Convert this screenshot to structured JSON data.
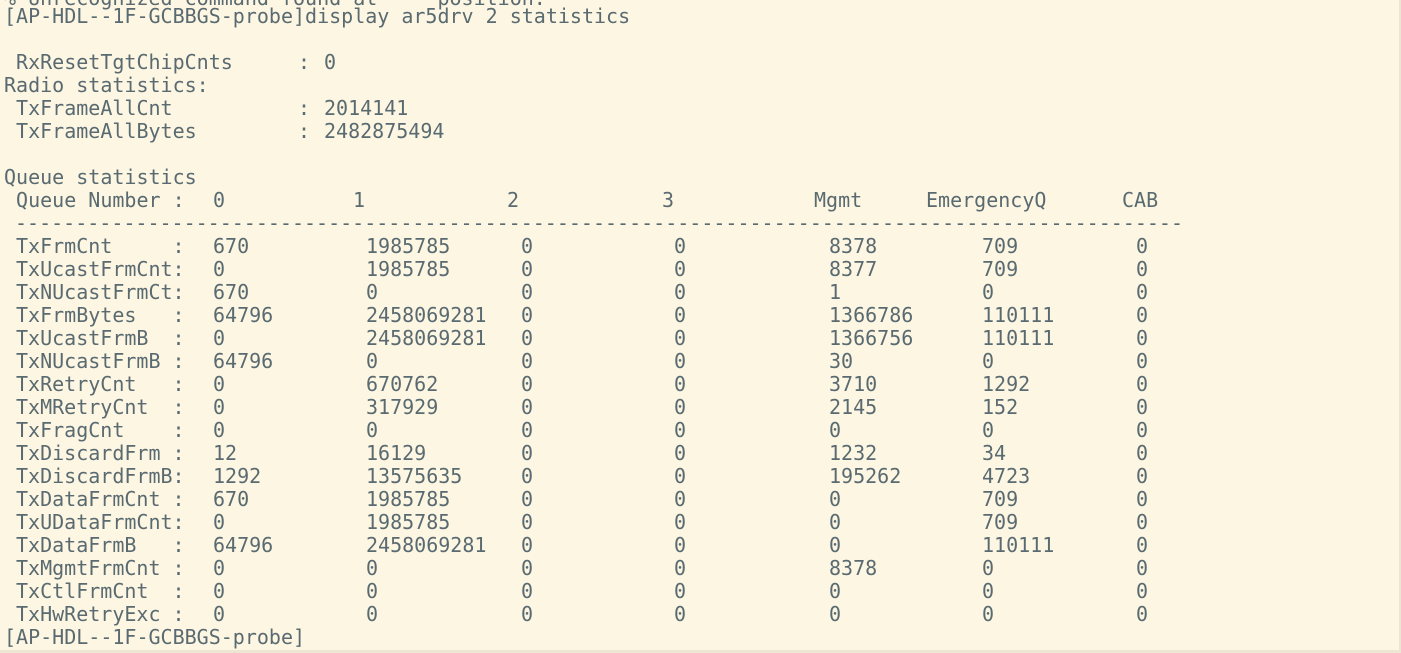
{
  "clipped_top_line": "% Unrecognized command found at '^' position.",
  "header": {
    "command_prompt": "[AP-HDL--1F-GCBBGS-probe]display ar5drv 2 statistics"
  },
  "reset": {
    "label": " RxResetTgtChipCnts",
    "sep": "  : ",
    "value": "0"
  },
  "radio": {
    "title": "Radio statistics:",
    "items": [
      {
        "label": " TxFrameAllCnt",
        "value": "2014141"
      },
      {
        "label": " TxFrameAllBytes",
        "value": "2482875494"
      }
    ]
  },
  "queue": {
    "title": "Queue statistics",
    "header_label": " Queue Number :",
    "columns": [
      "0",
      "1",
      "2",
      "3",
      "Mgmt",
      "EmergencyQ",
      "CAB"
    ],
    "separator": "------------------------------------------------------------------------------------------------------------------------------------",
    "rows": [
      {
        "name": "TxFrmCnt     :",
        "values": [
          "670",
          "1985785",
          "0",
          "0",
          "8378",
          "709",
          "0"
        ]
      },
      {
        "name": "TxUcastFrmCnt:",
        "values": [
          "0",
          "1985785",
          "0",
          "0",
          "8377",
          "709",
          "0"
        ]
      },
      {
        "name": "TxNUcastFrmCt:",
        "values": [
          "670",
          "0",
          "0",
          "0",
          "1",
          "0",
          "0"
        ]
      },
      {
        "name": "TxFrmBytes   :",
        "values": [
          "64796",
          "2458069281",
          "0",
          "0",
          "1366786",
          "110111",
          "0"
        ]
      },
      {
        "name": "TxUcastFrmB  :",
        "values": [
          "0",
          "2458069281",
          "0",
          "0",
          "1366756",
          "110111",
          "0"
        ]
      },
      {
        "name": "TxNUcastFrmB :",
        "values": [
          "64796",
          "0",
          "0",
          "0",
          "30",
          "0",
          "0"
        ]
      },
      {
        "name": "TxRetryCnt   :",
        "values": [
          "0",
          "670762",
          "0",
          "0",
          "3710",
          "1292",
          "0"
        ]
      },
      {
        "name": "TxMRetryCnt  :",
        "values": [
          "0",
          "317929",
          "0",
          "0",
          "2145",
          "152",
          "0"
        ]
      },
      {
        "name": "TxFragCnt    :",
        "values": [
          "0",
          "0",
          "0",
          "0",
          "0",
          "0",
          "0"
        ]
      },
      {
        "name": "TxDiscardFrm :",
        "values": [
          "12",
          "16129",
          "0",
          "0",
          "1232",
          "34",
          "0"
        ]
      },
      {
        "name": "TxDiscardFrmB:",
        "values": [
          "1292",
          "13575635",
          "0",
          "0",
          "195262",
          "4723",
          "0"
        ]
      },
      {
        "name": "TxDataFrmCnt :",
        "values": [
          "670",
          "1985785",
          "0",
          "0",
          "0",
          "709",
          "0"
        ]
      },
      {
        "name": "TxUDataFrmCnt:",
        "values": [
          "0",
          "1985785",
          "0",
          "0",
          "0",
          "709",
          "0"
        ]
      },
      {
        "name": "TxDataFrmB   :",
        "values": [
          "64796",
          "2458069281",
          "0",
          "0",
          "0",
          "110111",
          "0"
        ]
      },
      {
        "name": "TxMgmtFrmCnt :",
        "values": [
          "0",
          "0",
          "0",
          "0",
          "8378",
          "0",
          "0"
        ]
      },
      {
        "name": "TxCtlFrmCnt  :",
        "values": [
          "0",
          "0",
          "0",
          "0",
          "0",
          "0",
          "0"
        ]
      },
      {
        "name": "TxHwRetryExc :",
        "values": [
          "0",
          "0",
          "0",
          "0",
          "0",
          "0",
          "0"
        ]
      }
    ]
  },
  "footer": {
    "prompt": "[AP-HDL--1F-GCBBGS-probe]"
  }
}
